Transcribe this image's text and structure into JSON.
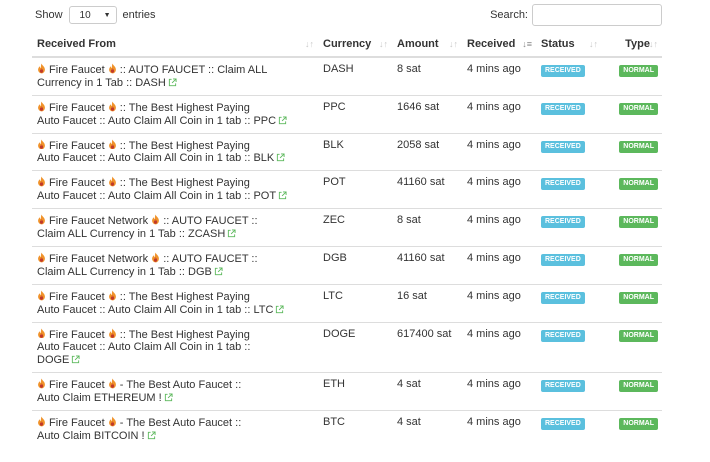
{
  "length": {
    "show_label": "Show",
    "selected": "10",
    "entries_label": "entries"
  },
  "search": {
    "label": "Search:",
    "value": ""
  },
  "table": {
    "headers": [
      "Received From",
      "Currency",
      "Amount",
      "Received",
      "Status",
      "Type"
    ],
    "rows": [
      {
        "from": [
          " Fire Faucet ",
          " :: AUTO FAUCET :: Claim ALL",
          "Currency in 1 Tab :: DASH"
        ],
        "currency": "DASH",
        "amount": "8 sat",
        "received": "4 mins ago",
        "status": "RECEIVED",
        "type": "NORMAL"
      },
      {
        "from": [
          " Fire Faucet ",
          " :: The Best Highest Paying",
          "Auto Faucet :: Auto Claim All Coin in 1 tab :: PPC"
        ],
        "currency": "PPC",
        "amount": "1646 sat",
        "received": "4 mins ago",
        "status": "RECEIVED",
        "type": "NORMAL"
      },
      {
        "from": [
          " Fire Faucet ",
          " :: The Best Highest Paying",
          "Auto Faucet :: Auto Claim All Coin in 1 tab :: BLK"
        ],
        "currency": "BLK",
        "amount": "2058 sat",
        "received": "4 mins ago",
        "status": "RECEIVED",
        "type": "NORMAL"
      },
      {
        "from": [
          " Fire Faucet ",
          " :: The Best Highest Paying",
          "Auto Faucet :: Auto Claim All Coin in 1 tab :: POT"
        ],
        "currency": "POT",
        "amount": "41160 sat",
        "received": "4 mins ago",
        "status": "RECEIVED",
        "type": "NORMAL"
      },
      {
        "from": [
          " Fire Faucet Network ",
          " :: AUTO FAUCET ::",
          "Claim ALL Currency in 1 Tab :: ZCASH"
        ],
        "currency": "ZEC",
        "amount": "8 sat",
        "received": "4 mins ago",
        "status": "RECEIVED",
        "type": "NORMAL"
      },
      {
        "from": [
          " Fire Faucet Network ",
          " :: AUTO FAUCET ::",
          "Claim ALL Currency in 1 Tab :: DGB"
        ],
        "currency": "DGB",
        "amount": "41160 sat",
        "received": "4 mins ago",
        "status": "RECEIVED",
        "type": "NORMAL"
      },
      {
        "from": [
          " Fire Faucet ",
          " :: The Best Highest Paying",
          "Auto Faucet :: Auto Claim All Coin in 1 tab :: LTC"
        ],
        "currency": "LTC",
        "amount": "16 sat",
        "received": "4 mins ago",
        "status": "RECEIVED",
        "type": "NORMAL"
      },
      {
        "from": [
          " Fire Faucet ",
          " :: The Best Highest Paying",
          "Auto Faucet :: Auto Claim All Coin in 1 tab ::",
          "DOGE"
        ],
        "currency": "DOGE",
        "amount": "617400 sat",
        "received": "4 mins ago",
        "status": "RECEIVED",
        "type": "NORMAL"
      },
      {
        "from": [
          " Fire Faucet ",
          " - The Best Auto Faucet ::",
          "Auto Claim ETHEREUM !"
        ],
        "currency": "ETH",
        "amount": "4 sat",
        "received": "4 mins ago",
        "status": "RECEIVED",
        "type": "NORMAL"
      },
      {
        "from": [
          " Fire Faucet ",
          " - The Best Auto Faucet ::",
          "Auto Claim BITCOIN !"
        ],
        "currency": "BTC",
        "amount": "4 sat",
        "received": "4 mins ago",
        "status": "RECEIVED",
        "type": "NORMAL"
      }
    ]
  },
  "colors": {
    "received_badge": "#5bc0de",
    "normal_badge": "#5cb85c",
    "link_icon": "#5cb85c",
    "flame": "#f0932b"
  }
}
